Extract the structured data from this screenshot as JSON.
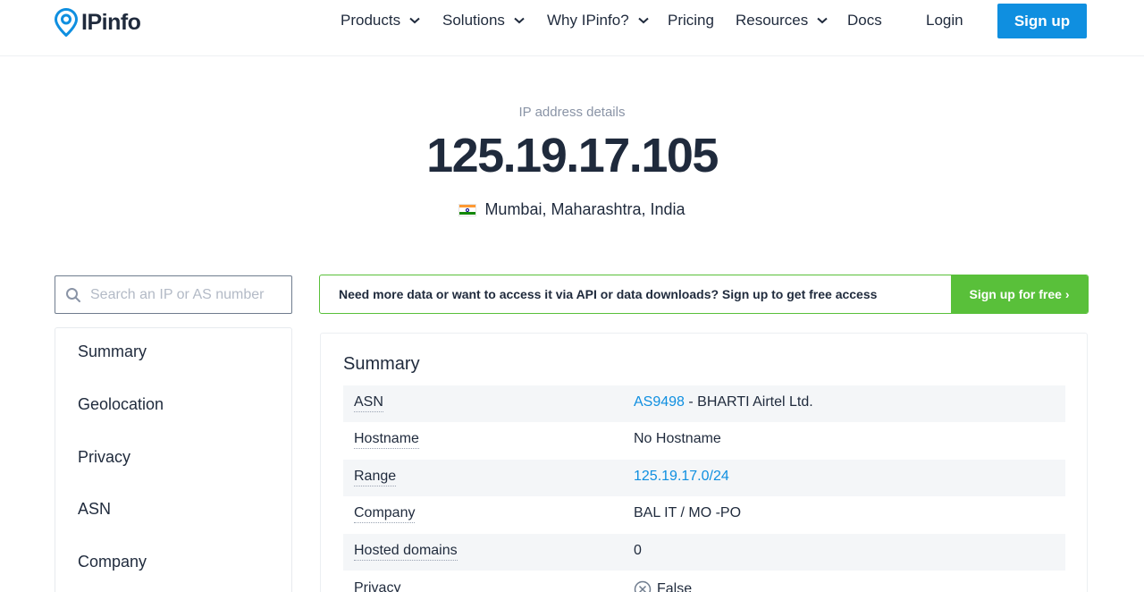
{
  "header": {
    "logo_text": "IPinfo",
    "nav": [
      {
        "label": "Products",
        "dropdown": true
      },
      {
        "label": "Solutions",
        "dropdown": true
      },
      {
        "label": "Why IPinfo?",
        "dropdown": true
      },
      {
        "label": "Pricing",
        "dropdown": false
      },
      {
        "label": "Resources",
        "dropdown": true
      },
      {
        "label": "Docs",
        "dropdown": false
      }
    ],
    "login_label": "Login",
    "signup_label": "Sign up"
  },
  "hero": {
    "subtitle": "IP address details",
    "ip": "125.19.17.105",
    "location": "Mumbai, Maharashtra, India",
    "flag_icon": "india-flag-icon"
  },
  "search": {
    "placeholder": "Search an IP or AS number",
    "value": ""
  },
  "sidebar": {
    "items": [
      {
        "label": "Summary"
      },
      {
        "label": "Geolocation"
      },
      {
        "label": "Privacy"
      },
      {
        "label": "ASN"
      },
      {
        "label": "Company"
      }
    ]
  },
  "banner": {
    "text": "Need more data or want to access it via API or data downloads? Sign up to get free access",
    "button_label": "Sign up for free ›"
  },
  "summary": {
    "title": "Summary",
    "rows": [
      {
        "label": "ASN",
        "link": "AS9498",
        "value": " - BHARTI Airtel Ltd."
      },
      {
        "label": "Hostname",
        "link": "",
        "value": "No Hostname"
      },
      {
        "label": "Range",
        "link": "125.19.17.0/24",
        "value": ""
      },
      {
        "label": "Company",
        "link": "",
        "value": "BAL IT / MO -PO"
      },
      {
        "label": "Hosted domains",
        "link": "",
        "value": "0"
      },
      {
        "label": "Privacy",
        "link": "",
        "value": "False",
        "icon": "x-circle-icon"
      }
    ]
  },
  "colors": {
    "accent": "#0f8fe0",
    "green": "#59c03a",
    "text": "#1f2a3c"
  }
}
